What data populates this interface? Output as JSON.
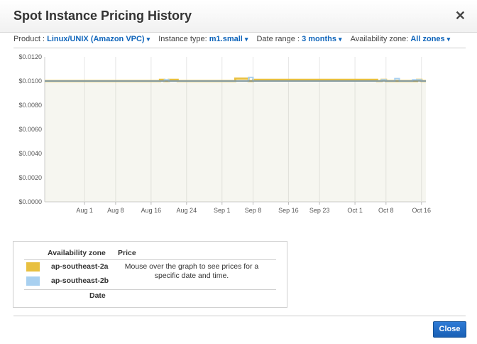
{
  "dialog": {
    "title": "Spot Instance Pricing History",
    "close_icon": "close-icon"
  },
  "filters": {
    "product_label": "Product :",
    "product_value": "Linux/UNIX (Amazon VPC)",
    "instance_type_label": "Instance type:",
    "instance_type_value": "m1.small",
    "date_range_label": "Date range :",
    "date_range_value": "3 months",
    "az_label": "Availability zone:",
    "az_value": "All zones"
  },
  "chart_data": {
    "type": "line",
    "ylabel": "",
    "xlabel": "",
    "y_ticks": [
      "$0.0120",
      "$0.0100",
      "$0.0080",
      "$0.0060",
      "$0.0040",
      "$0.0020",
      "$0.0000"
    ],
    "ylim": [
      0,
      0.012
    ],
    "x_ticks": [
      "Aug 1",
      "Aug 8",
      "Aug 16",
      "Aug 24",
      "Sep 1",
      "Sep 8",
      "Sep 16",
      "Sep 23",
      "Oct 1",
      "Oct 8",
      "Oct 16"
    ],
    "grid": true,
    "series": [
      {
        "name": "ap-southeast-2a",
        "color": "#e8c040",
        "x": [
          "Jul 23",
          "Aug 17",
          "Aug 18",
          "Aug 19",
          "Aug 20",
          "Aug 21",
          "Aug 22",
          "Sep 3",
          "Sep 4",
          "Sep 7",
          "Sep 8",
          "Oct 6",
          "Oct 7",
          "Oct 8",
          "Oct 14",
          "Oct 15",
          "Oct 16"
        ],
        "values": [
          0.01,
          0.01,
          0.0101,
          0.01,
          0.0101,
          0.0101,
          0.01,
          0.01,
          0.0102,
          0.01,
          0.0101,
          0.01,
          0.0101,
          0.01,
          0.01,
          0.0101,
          0.01
        ]
      },
      {
        "name": "ap-southeast-2b",
        "color": "#a8d0f0",
        "x": [
          "Jul 23",
          "Aug 17",
          "Aug 19",
          "Aug 20",
          "Sep 6",
          "Sep 7",
          "Sep 8",
          "Oct 6",
          "Oct 7",
          "Oct 8",
          "Oct 10",
          "Oct 11",
          "Oct 14",
          "Oct 16"
        ],
        "values": [
          0.01,
          0.01,
          0.0101,
          0.01,
          0.01,
          0.0103,
          0.01,
          0.01,
          0.0101,
          0.01,
          0.0102,
          0.01,
          0.0101,
          0.01
        ]
      }
    ]
  },
  "legend": {
    "zone_header": "Availability zone",
    "price_header": "Price",
    "zones": [
      {
        "name": "ap-southeast-2a",
        "color": "#e8c040"
      },
      {
        "name": "ap-southeast-2b",
        "color": "#a8d0f0"
      }
    ],
    "message": "Mouse over the graph to see prices for a specific date and time.",
    "date_label": "Date"
  },
  "footer": {
    "close_label": "Close"
  }
}
